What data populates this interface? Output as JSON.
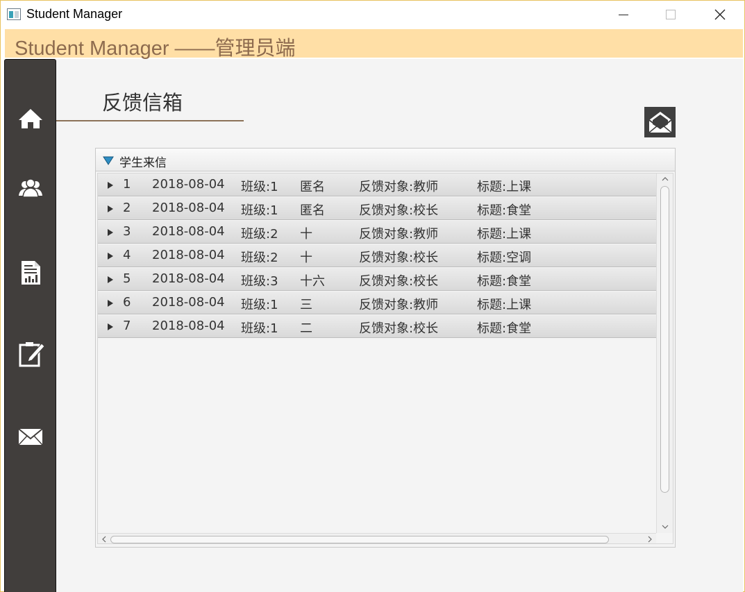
{
  "window": {
    "title": "Student Manager",
    "icon": "app-window-icon"
  },
  "header": {
    "title": "Student Manager ——管理员端"
  },
  "sidebar": {
    "items": [
      {
        "icon": "home-icon"
      },
      {
        "icon": "users-icon"
      },
      {
        "icon": "report-icon"
      },
      {
        "icon": "edit-icon"
      },
      {
        "icon": "mail-icon"
      }
    ]
  },
  "page": {
    "title": "反馈信箱",
    "action_icon": "mail-open-icon"
  },
  "pane": {
    "title": "学生来信",
    "rows": [
      {
        "id": "1",
        "date": "2018-08-04",
        "class": "班级:1",
        "name": "匿名",
        "target": "反馈对象:教师",
        "subject": "标题:上课"
      },
      {
        "id": "2",
        "date": "2018-08-04",
        "class": "班级:1",
        "name": "匿名",
        "target": "反馈对象:校长",
        "subject": "标题:食堂"
      },
      {
        "id": "3",
        "date": "2018-08-04",
        "class": "班级:2",
        "name": "十",
        "target": "反馈对象:教师",
        "subject": "标题:上课"
      },
      {
        "id": "4",
        "date": "2018-08-04",
        "class": "班级:2",
        "name": "十",
        "target": "反馈对象:校长",
        "subject": "标题:空调"
      },
      {
        "id": "5",
        "date": "2018-08-04",
        "class": "班级:3",
        "name": "十六",
        "target": "反馈对象:校长",
        "subject": "标题:食堂"
      },
      {
        "id": "6",
        "date": "2018-08-04",
        "class": "班级:1",
        "name": "三",
        "target": "反馈对象:教师",
        "subject": "标题:上课"
      },
      {
        "id": "7",
        "date": "2018-08-04",
        "class": "班级:1",
        "name": "二",
        "target": "反馈对象:校长",
        "subject": "标题:食堂"
      }
    ]
  },
  "colors": {
    "header_bg": "#ffdfa6",
    "header_text": "#8d6b4e",
    "sidebar_bg": "#413e3c",
    "accent_line": "#8b7158",
    "pane_arrow": "#2e8ec4"
  }
}
